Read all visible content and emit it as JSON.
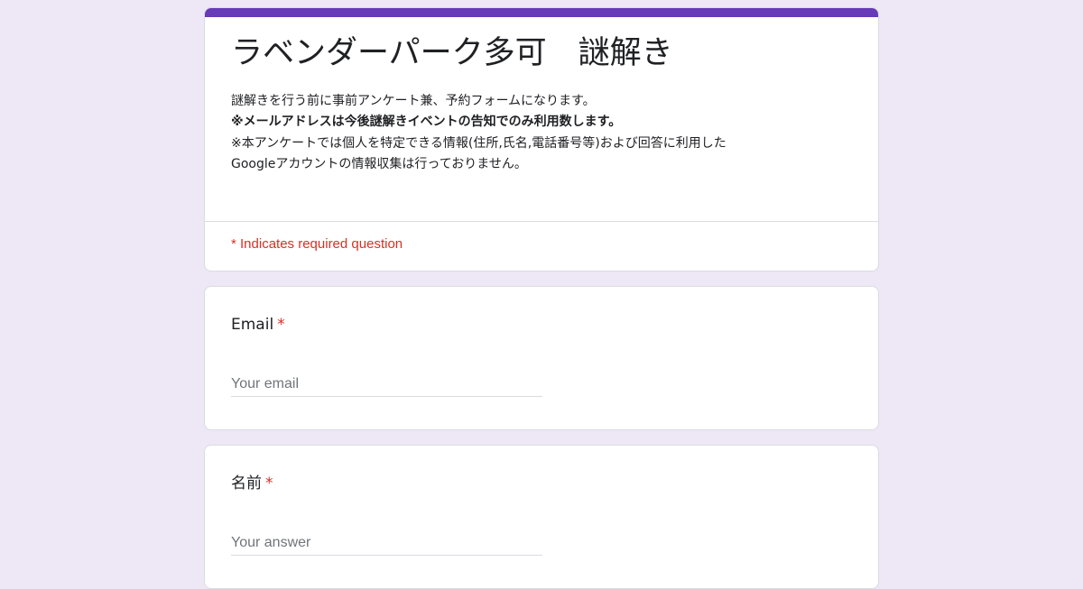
{
  "colors": {
    "background": "#ede7f6",
    "accent": "#673ab7",
    "required": "#d93025",
    "text": "#202124",
    "placeholder": "#70757a"
  },
  "form": {
    "title": "ラベンダーパーク多可　謎解き",
    "description": [
      {
        "text": "謎解きを行う前に事前アンケート兼、予約フォームになります。",
        "bold": false
      },
      {
        "text": "※メールアドレスは今後謎解きイベントの告知でのみ利用数します。",
        "bold": true
      },
      {
        "text": "※本アンケートでは個人を特定できる情報(住所,氏名,電話番号等)および回答に利用した",
        "bold": false
      },
      {
        "text": "Googleアカウントの情報収集は行っておりません。",
        "bold": false
      }
    ],
    "required_note": "* Indicates required question"
  },
  "questions": [
    {
      "label": "Email",
      "required_mark": "*",
      "placeholder": "Your email",
      "value": ""
    },
    {
      "label": "名前",
      "required_mark": "*",
      "placeholder": "Your answer",
      "value": ""
    }
  ]
}
